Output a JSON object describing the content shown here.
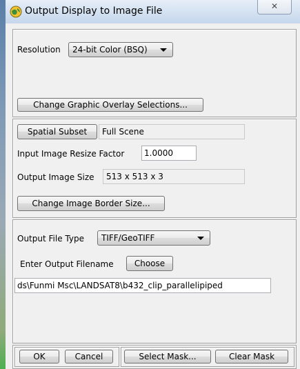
{
  "window": {
    "title": "Output Display to Image File",
    "close_glyph": "✕",
    "icon": "envi-globe-icon"
  },
  "resolution": {
    "label": "Resolution",
    "selected": "24-bit Color (BSQ)"
  },
  "overlay": {
    "button": "Change Graphic Overlay Selections..."
  },
  "subset": {
    "button": "Spatial Subset",
    "value": "Full Scene"
  },
  "resize": {
    "label": "Input Image Resize Factor",
    "value": "1.0000"
  },
  "output_size": {
    "label": "Output Image Size",
    "value": "513 x 513 x 3"
  },
  "border": {
    "button": "Change Image Border Size..."
  },
  "file_type": {
    "label": "Output File Type",
    "selected": "TIFF/GeoTIFF"
  },
  "filename": {
    "label": "Enter Output Filename",
    "choose_button": "Choose",
    "value": "ds\\Funmi Msc\\LANDSAT8\\b432_clip_parallelipiped"
  },
  "actions": {
    "ok": "OK",
    "cancel": "Cancel",
    "select_mask": "Select Mask...",
    "clear_mask": "Clear Mask"
  }
}
